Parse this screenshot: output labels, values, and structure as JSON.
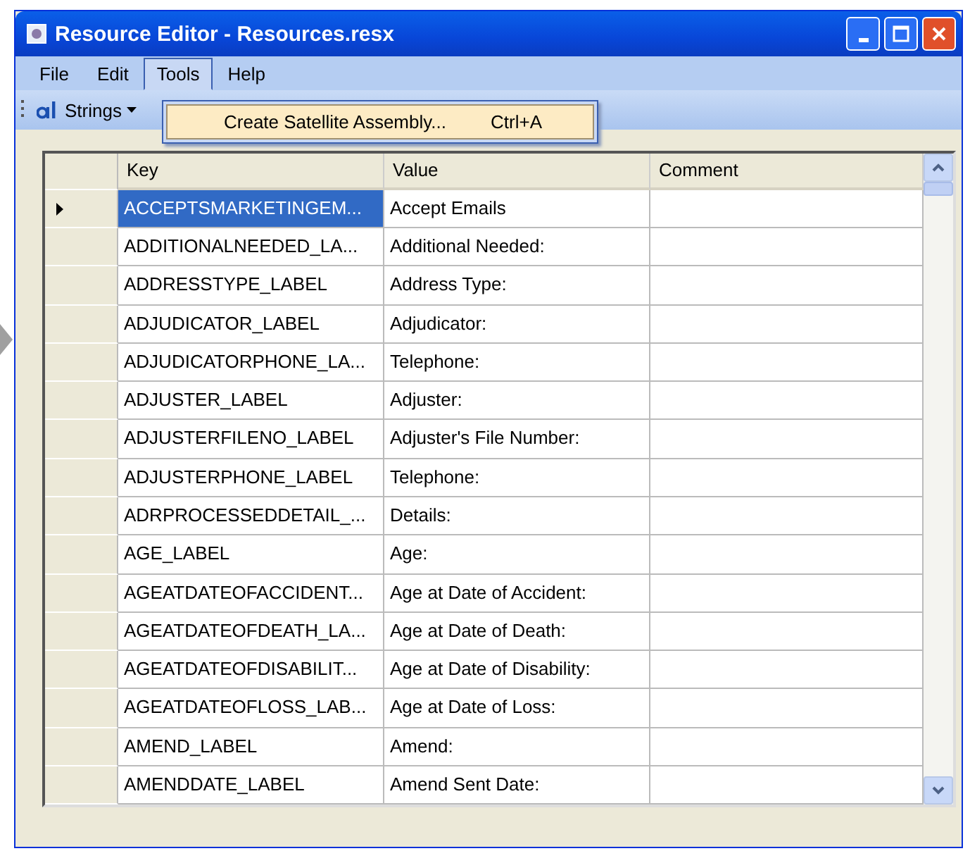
{
  "window": {
    "title": "Resource Editor - Resources.resx"
  },
  "menu": [
    {
      "label": "File",
      "selected": false
    },
    {
      "label": "Edit",
      "selected": false
    },
    {
      "label": "Tools",
      "selected": true
    },
    {
      "label": "Help",
      "selected": false
    }
  ],
  "dropdown": [
    {
      "label": "Create Satellite Assembly...",
      "shortcut": "Ctrl+A",
      "selected": true
    }
  ],
  "toolbar": {
    "strings_button": "Strings"
  },
  "table": {
    "columns": [
      "Key",
      "Value",
      "Comment"
    ],
    "rows": [
      {
        "key": "ACCEPTSMARKETINGEM...",
        "value": "Accept Emails",
        "selected": true
      },
      {
        "key": "ADDITIONALNEEDED_LA...",
        "value": "Additional Needed:",
        "selected": false
      },
      {
        "key": "ADDRESSTYPE_LABEL",
        "value": "Address Type:",
        "selected": false
      },
      {
        "key": "ADJUDICATOR_LABEL",
        "value": "Adjudicator:",
        "selected": false
      },
      {
        "key": "ADJUDICATORPHONE_LA...",
        "value": "Telephone:",
        "selected": false
      },
      {
        "key": "ADJUSTER_LABEL",
        "value": "Adjuster:",
        "selected": false
      },
      {
        "key": "ADJUSTERFILENO_LABEL",
        "value": "Adjuster's File Number:",
        "selected": false
      },
      {
        "key": "ADJUSTERPHONE_LABEL",
        "value": "Telephone:",
        "selected": false
      },
      {
        "key": "ADRPROCESSEDDETAIL_...",
        "value": "Details:",
        "selected": false
      },
      {
        "key": "AGE_LABEL",
        "value": "Age:",
        "selected": false
      },
      {
        "key": "AGEATDATEOFACCIDENT...",
        "value": "Age at Date of Accident:",
        "selected": false
      },
      {
        "key": "AGEATDATEOFDEATH_LA...",
        "value": "Age at Date of Death:",
        "selected": false
      },
      {
        "key": "AGEATDATEOFDISABILIT...",
        "value": "Age at Date of Disability:",
        "selected": false
      },
      {
        "key": "AGEATDATEOFLOSS_LAB...",
        "value": "Age at Date of Loss:",
        "selected": false
      },
      {
        "key": "AMEND_LABEL",
        "value": "Amend:",
        "selected": false
      },
      {
        "key": "AMENDDATE_LABEL",
        "value": "Amend Sent Date:",
        "selected": false
      }
    ]
  }
}
